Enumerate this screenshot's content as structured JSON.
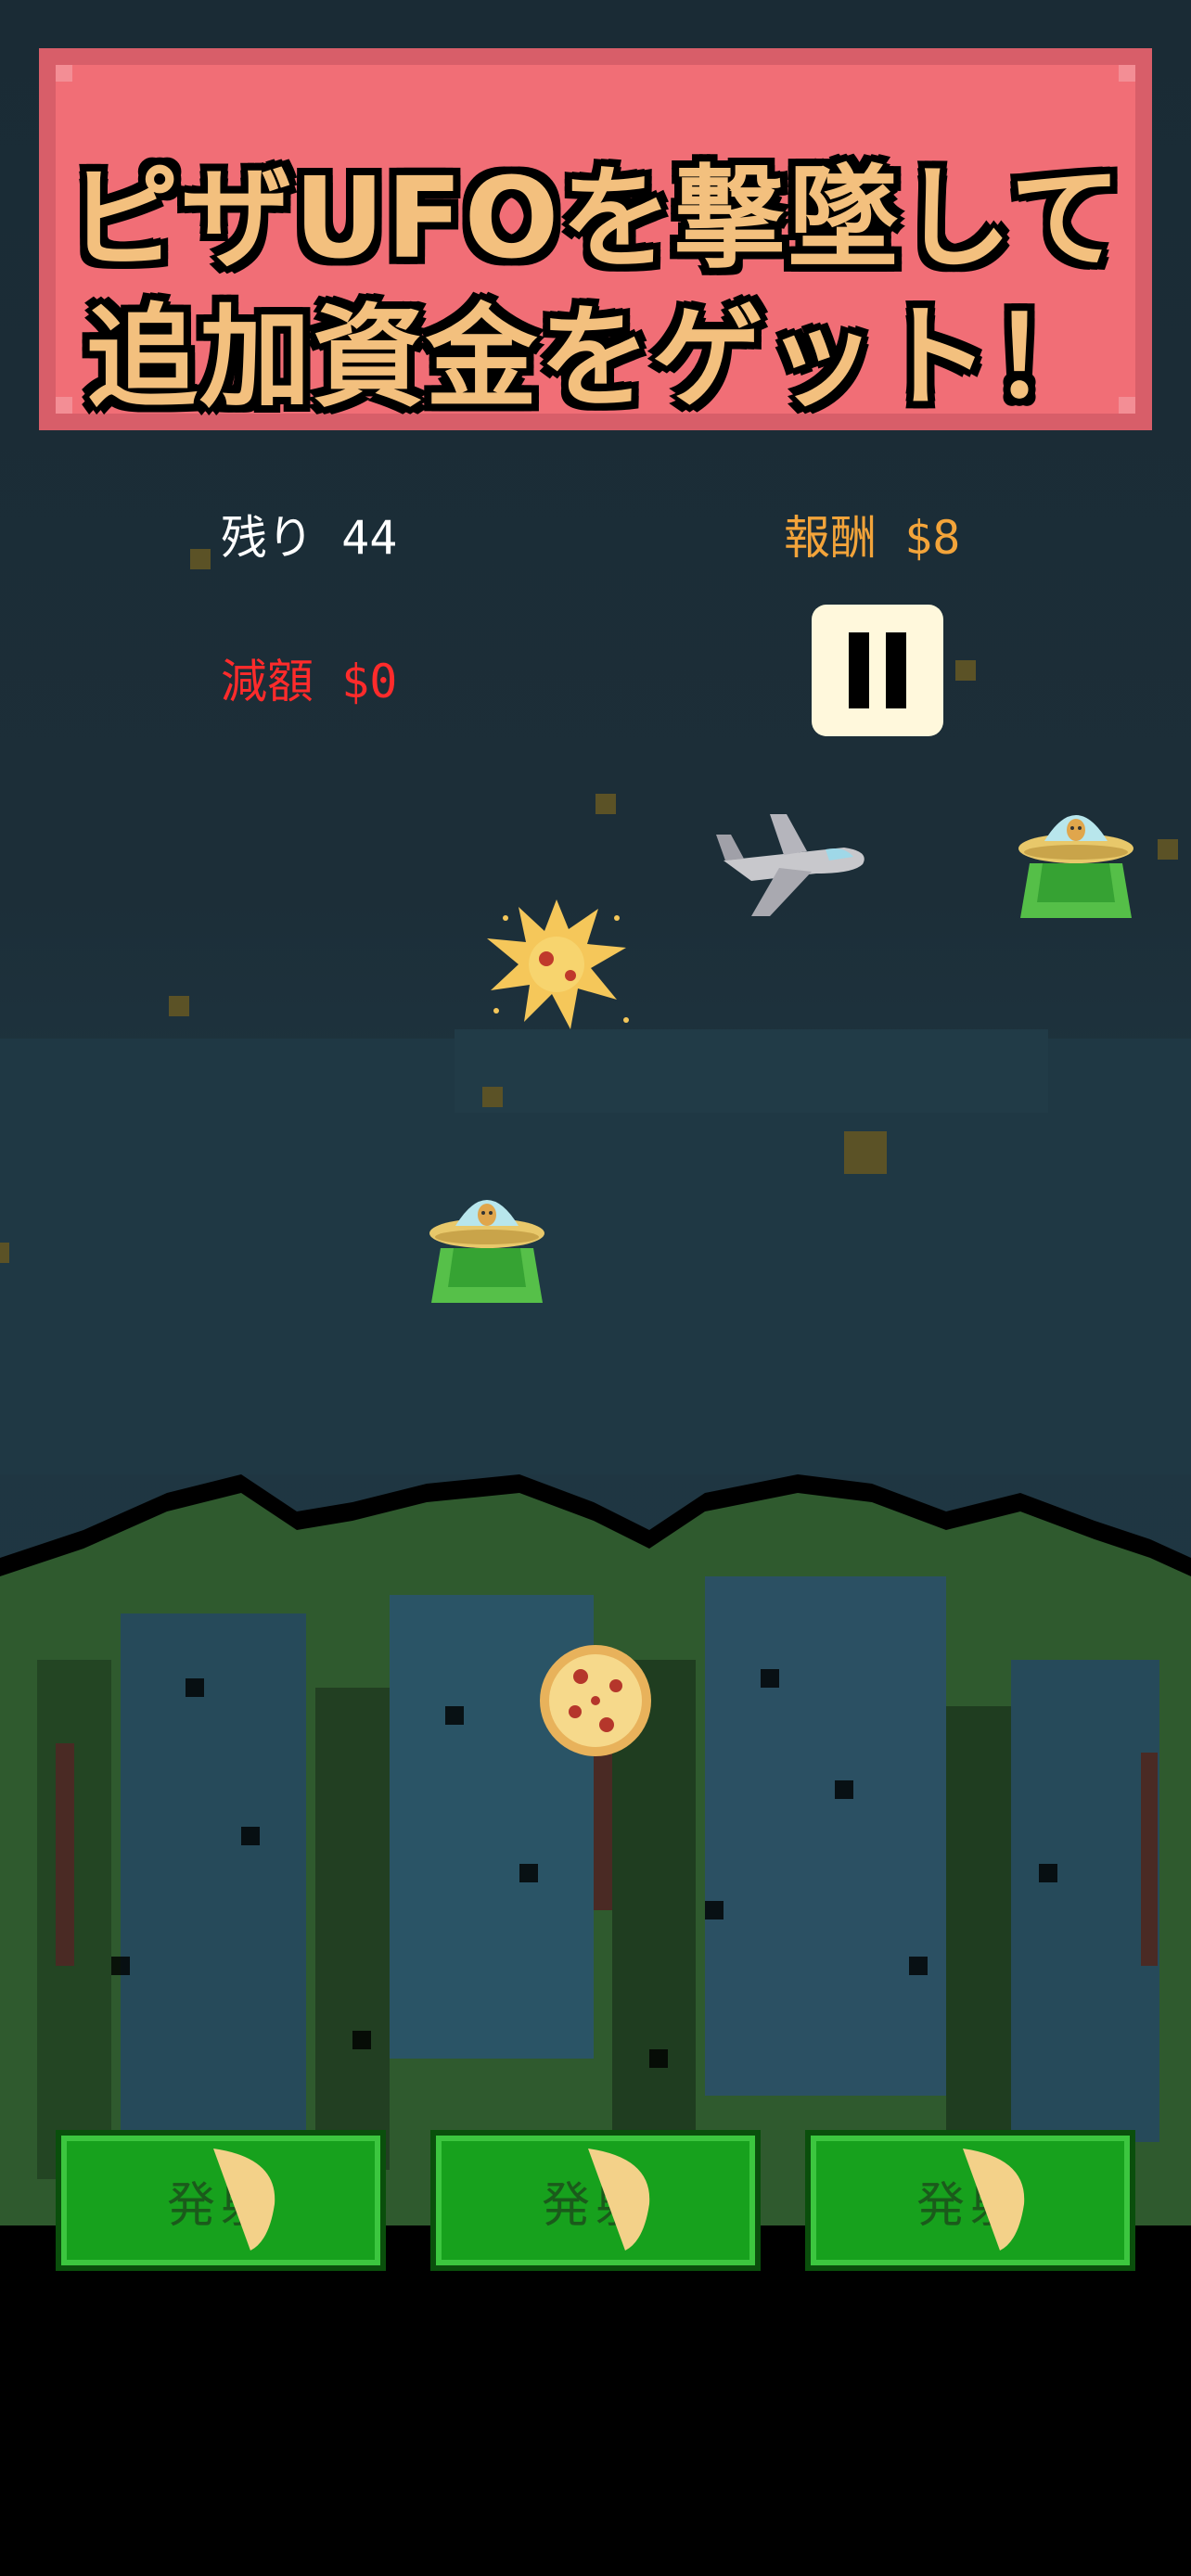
{
  "banner": {
    "line1": "ピザUFOを撃墜して",
    "line2": "追加資金をゲット！"
  },
  "hud": {
    "remaining": "残り 44",
    "reward": "報酬 $8",
    "deduction": "減額 $0"
  },
  "buttons": [
    {
      "label": "発射"
    },
    {
      "label": "発射"
    },
    {
      "label": "発射"
    }
  ],
  "icons": [
    "pause-icon",
    "ufo-icon",
    "airplane-icon",
    "pizza-icon",
    "explosion-icon",
    "pizza-slice-icon"
  ],
  "colors": {
    "banner": "#f16e76",
    "banner_text": "#f3c07e",
    "remaining_text": "#ffffff",
    "reward_text": "#f3a43a",
    "deduction_text": "#ff2b2b",
    "button": "#17a11d"
  }
}
